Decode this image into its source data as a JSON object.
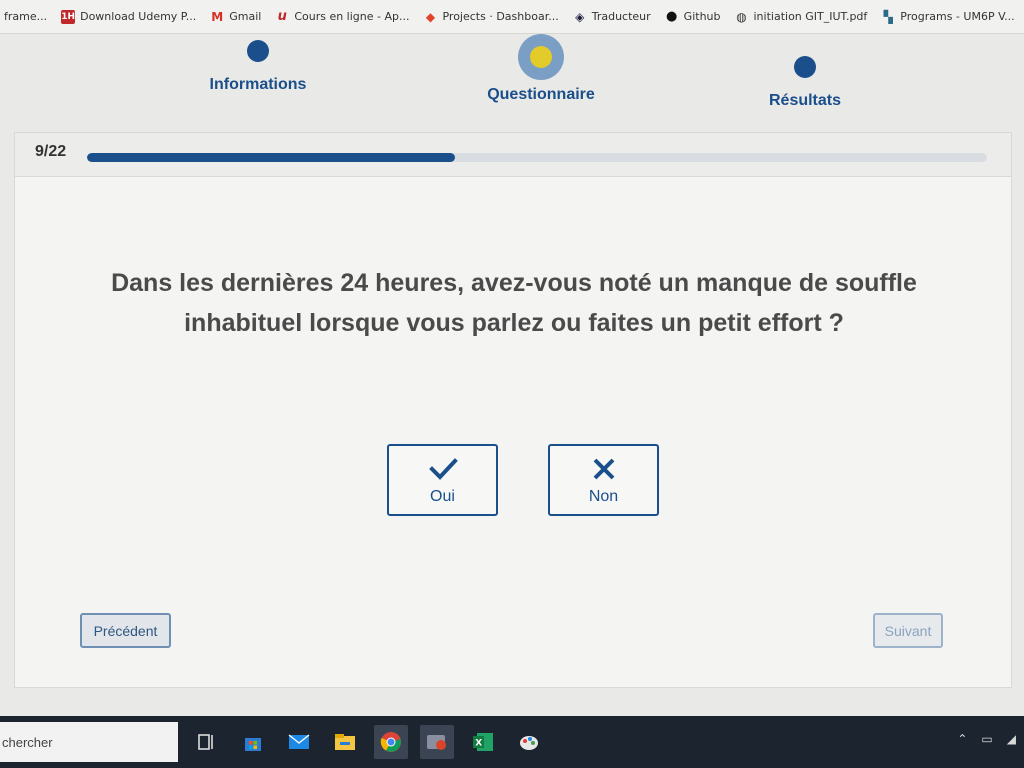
{
  "bookmarks": [
    {
      "label": "frame...",
      "icon": "none"
    },
    {
      "label": "Download Udemy P...",
      "icon": "1h-icon",
      "badge": "1H",
      "color": "#c0282a"
    },
    {
      "label": "Gmail",
      "icon": "gmail-icon",
      "badge": "M",
      "color": "#d93025"
    },
    {
      "label": "Cours en ligne - Ap...",
      "icon": "udemy-icon",
      "badge": "u",
      "color": "#c0282a"
    },
    {
      "label": "Projects · Dashboar...",
      "icon": "gitlab-icon",
      "badge": "◆",
      "color": "#e2432a"
    },
    {
      "label": "Traducteur",
      "icon": "translator-icon",
      "badge": "◈",
      "color": "#1b1b3a"
    },
    {
      "label": "Github",
      "icon": "github-icon",
      "badge": "●",
      "color": "#111111"
    },
    {
      "label": "initiation GIT_IUT.pdf",
      "icon": "globe-icon",
      "badge": "◍",
      "color": "#333333"
    },
    {
      "label": "Programs - UM6P V...",
      "icon": "programs-icon",
      "badge": "▚",
      "color": "#2a6a8a"
    }
  ],
  "steps": [
    {
      "label": "Informations",
      "state": "done"
    },
    {
      "label": "Questionnaire",
      "state": "active"
    },
    {
      "label": "Résultats",
      "state": "pending"
    }
  ],
  "progress": {
    "text": "9/22",
    "current": 9,
    "total": 22,
    "fraction": 0.409
  },
  "question": {
    "text": "Dans les dernières 24 heures, avez-vous noté un manque de souffle inhabituel lorsque vous parlez ou faites un petit effort ?"
  },
  "answers": {
    "yes": {
      "label": "Oui",
      "icon": "checkmark-icon"
    },
    "no": {
      "label": "Non",
      "icon": "x-icon"
    }
  },
  "nav": {
    "prev_label": "Précédent",
    "next_label": "Suivant"
  },
  "taskbar": {
    "search_text": "chercher",
    "apps": [
      "task-view-icon",
      "store-icon",
      "mail-icon",
      "file-explorer-icon",
      "chrome-icon",
      "app-icon",
      "excel-icon",
      "paint-icon"
    ]
  },
  "colors": {
    "primary": "#1a4f8c",
    "active_dot": "#e3cc2a",
    "active_ring": "#7b9fc4"
  }
}
